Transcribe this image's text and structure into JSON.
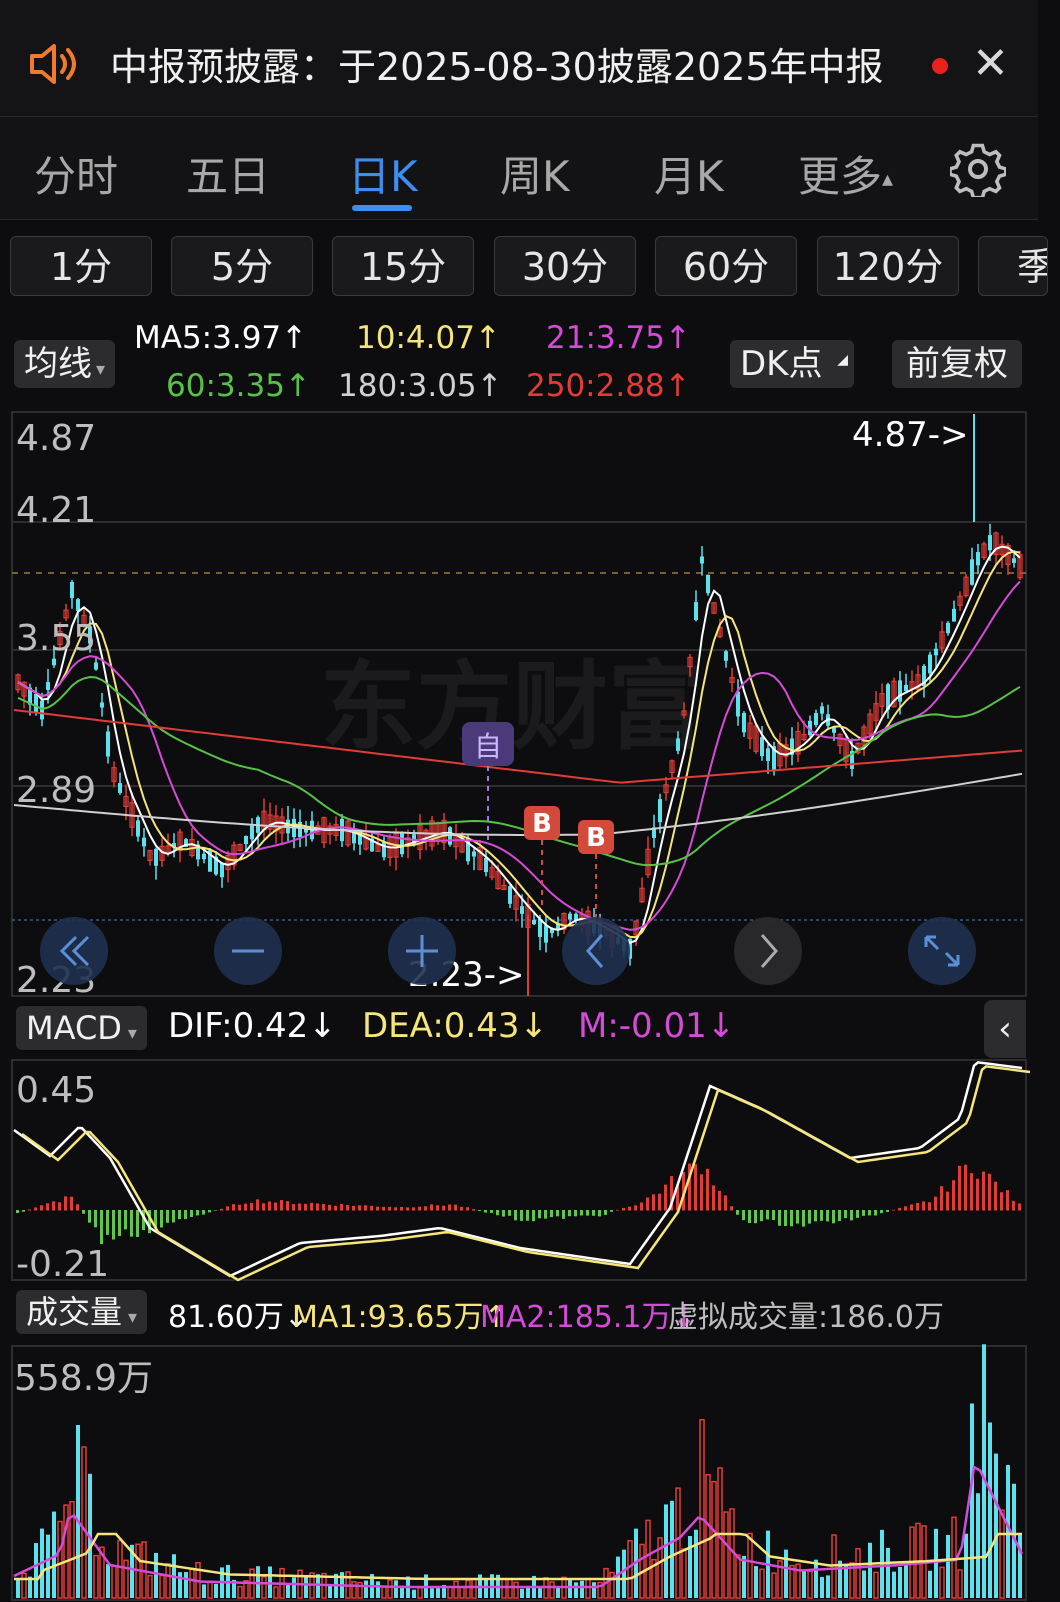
{
  "banner": {
    "text": "中报预披露：于2025-08-30披露2025年中报",
    "speaker_icon": "speaker-icon",
    "close_icon": "close-icon"
  },
  "tabs": [
    {
      "label": "分时",
      "active": false
    },
    {
      "label": "五日",
      "active": false
    },
    {
      "label": "日K",
      "active": true
    },
    {
      "label": "周K",
      "active": false
    },
    {
      "label": "月K",
      "active": false
    },
    {
      "label": "更多",
      "active": false
    }
  ],
  "tabs_more_arrow": "▴",
  "settings_icon": "gear-icon",
  "periods": [
    "1分",
    "5分",
    "15分",
    "30分",
    "60分",
    "120分",
    "季"
  ],
  "ma": {
    "selector": "均线",
    "ma5": "MA5:3.97",
    "ma10": "10:4.07",
    "ma21": "21:3.75",
    "ma60": "60:3.35",
    "ma180": "180:3.05",
    "ma250": "250:2.88",
    "up_arrow": "↑",
    "colors": {
      "ma5": "#ffffff",
      "ma10": "#f5e57a",
      "ma21": "#d54bd8",
      "ma60": "#58c248",
      "ma180": "#d0d0d0",
      "ma250": "#e13c36"
    },
    "dk_button": "DK点",
    "fq_button": "前复权"
  },
  "kchart": {
    "y_labels": [
      "4.87",
      "4.21",
      "3.55",
      "2.89",
      "2.23"
    ],
    "max_marker": "4.87->",
    "min_marker": "2.23->",
    "watermark": "东方财富",
    "self_marker": "自",
    "buy_markers": [
      "B",
      "B"
    ],
    "up_color": "#e33b35",
    "down_color": "#5ce1ee"
  },
  "controls": [
    "double-left-icon",
    "zoom-out-icon",
    "zoom-in-icon",
    "left-icon",
    "right-icon",
    "fullscreen-icon"
  ],
  "macd": {
    "selector": "MACD",
    "dif": "DIF:0.42",
    "dea": "DEA:0.43",
    "m": "M:-0.01",
    "down_arrow": "↓",
    "y_top": "0.45",
    "y_bottom": "-0.21"
  },
  "volume": {
    "selector": "成交量",
    "vol": "81.60万",
    "ma1": "MA1:93.65万",
    "ma2": "MA2:185.1万",
    "virtual": "虚拟成交量:186.0万",
    "down_arrow": "↓",
    "up_arrow": "↑",
    "y_top": "558.9万"
  },
  "chart_data": {
    "type": "candlestick",
    "y_range": [
      2.23,
      4.87
    ],
    "max_price": 4.87,
    "min_price": 2.23,
    "last_ma": {
      "MA5": 3.97,
      "MA10": 4.07,
      "MA21": 3.75,
      "MA60": 3.35,
      "MA180": 3.05,
      "MA250": 2.88
    },
    "macd_range": [
      -0.21,
      0.45
    ],
    "macd_last": {
      "DIF": 0.42,
      "DEA": 0.43,
      "M": -0.01
    },
    "volume_max": "558.9万",
    "volume_last": {
      "VOL": "81.60万",
      "MA1": "93.65万",
      "MA2": "185.1万"
    }
  }
}
